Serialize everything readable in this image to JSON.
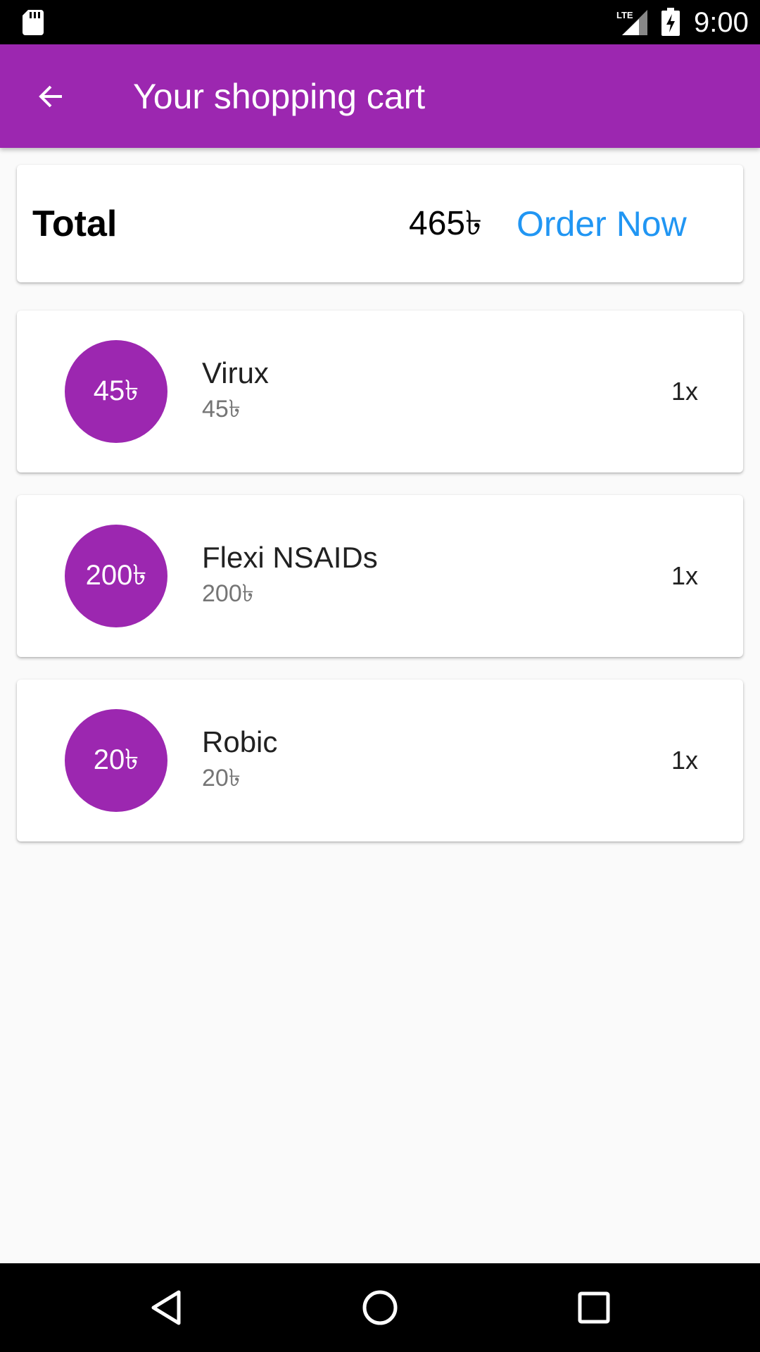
{
  "status_bar": {
    "time": "9:00",
    "network": "LTE",
    "icons": [
      "sd-card-icon",
      "lte-signal-icon",
      "battery-charging-icon"
    ]
  },
  "app_bar": {
    "title": "Your shopping cart",
    "back_icon": "arrow-back-icon"
  },
  "summary": {
    "total_label": "Total",
    "total_amount": "465৳",
    "order_button": "Order Now"
  },
  "cart_items": [
    {
      "badge": "45৳",
      "name": "Virux",
      "price": "45৳",
      "quantity": "1x"
    },
    {
      "badge": "200৳",
      "name": "Flexi NSAIDs",
      "price": "200৳",
      "quantity": "1x"
    },
    {
      "badge": "20৳",
      "name": "Robic",
      "price": "20৳",
      "quantity": "1x"
    }
  ],
  "colors": {
    "primary": "#9c27b0",
    "accent": "#2196f3",
    "background": "#fafafa"
  },
  "nav_bar": {
    "buttons": [
      "back-triangle-icon",
      "home-circle-icon",
      "recents-square-icon"
    ]
  }
}
